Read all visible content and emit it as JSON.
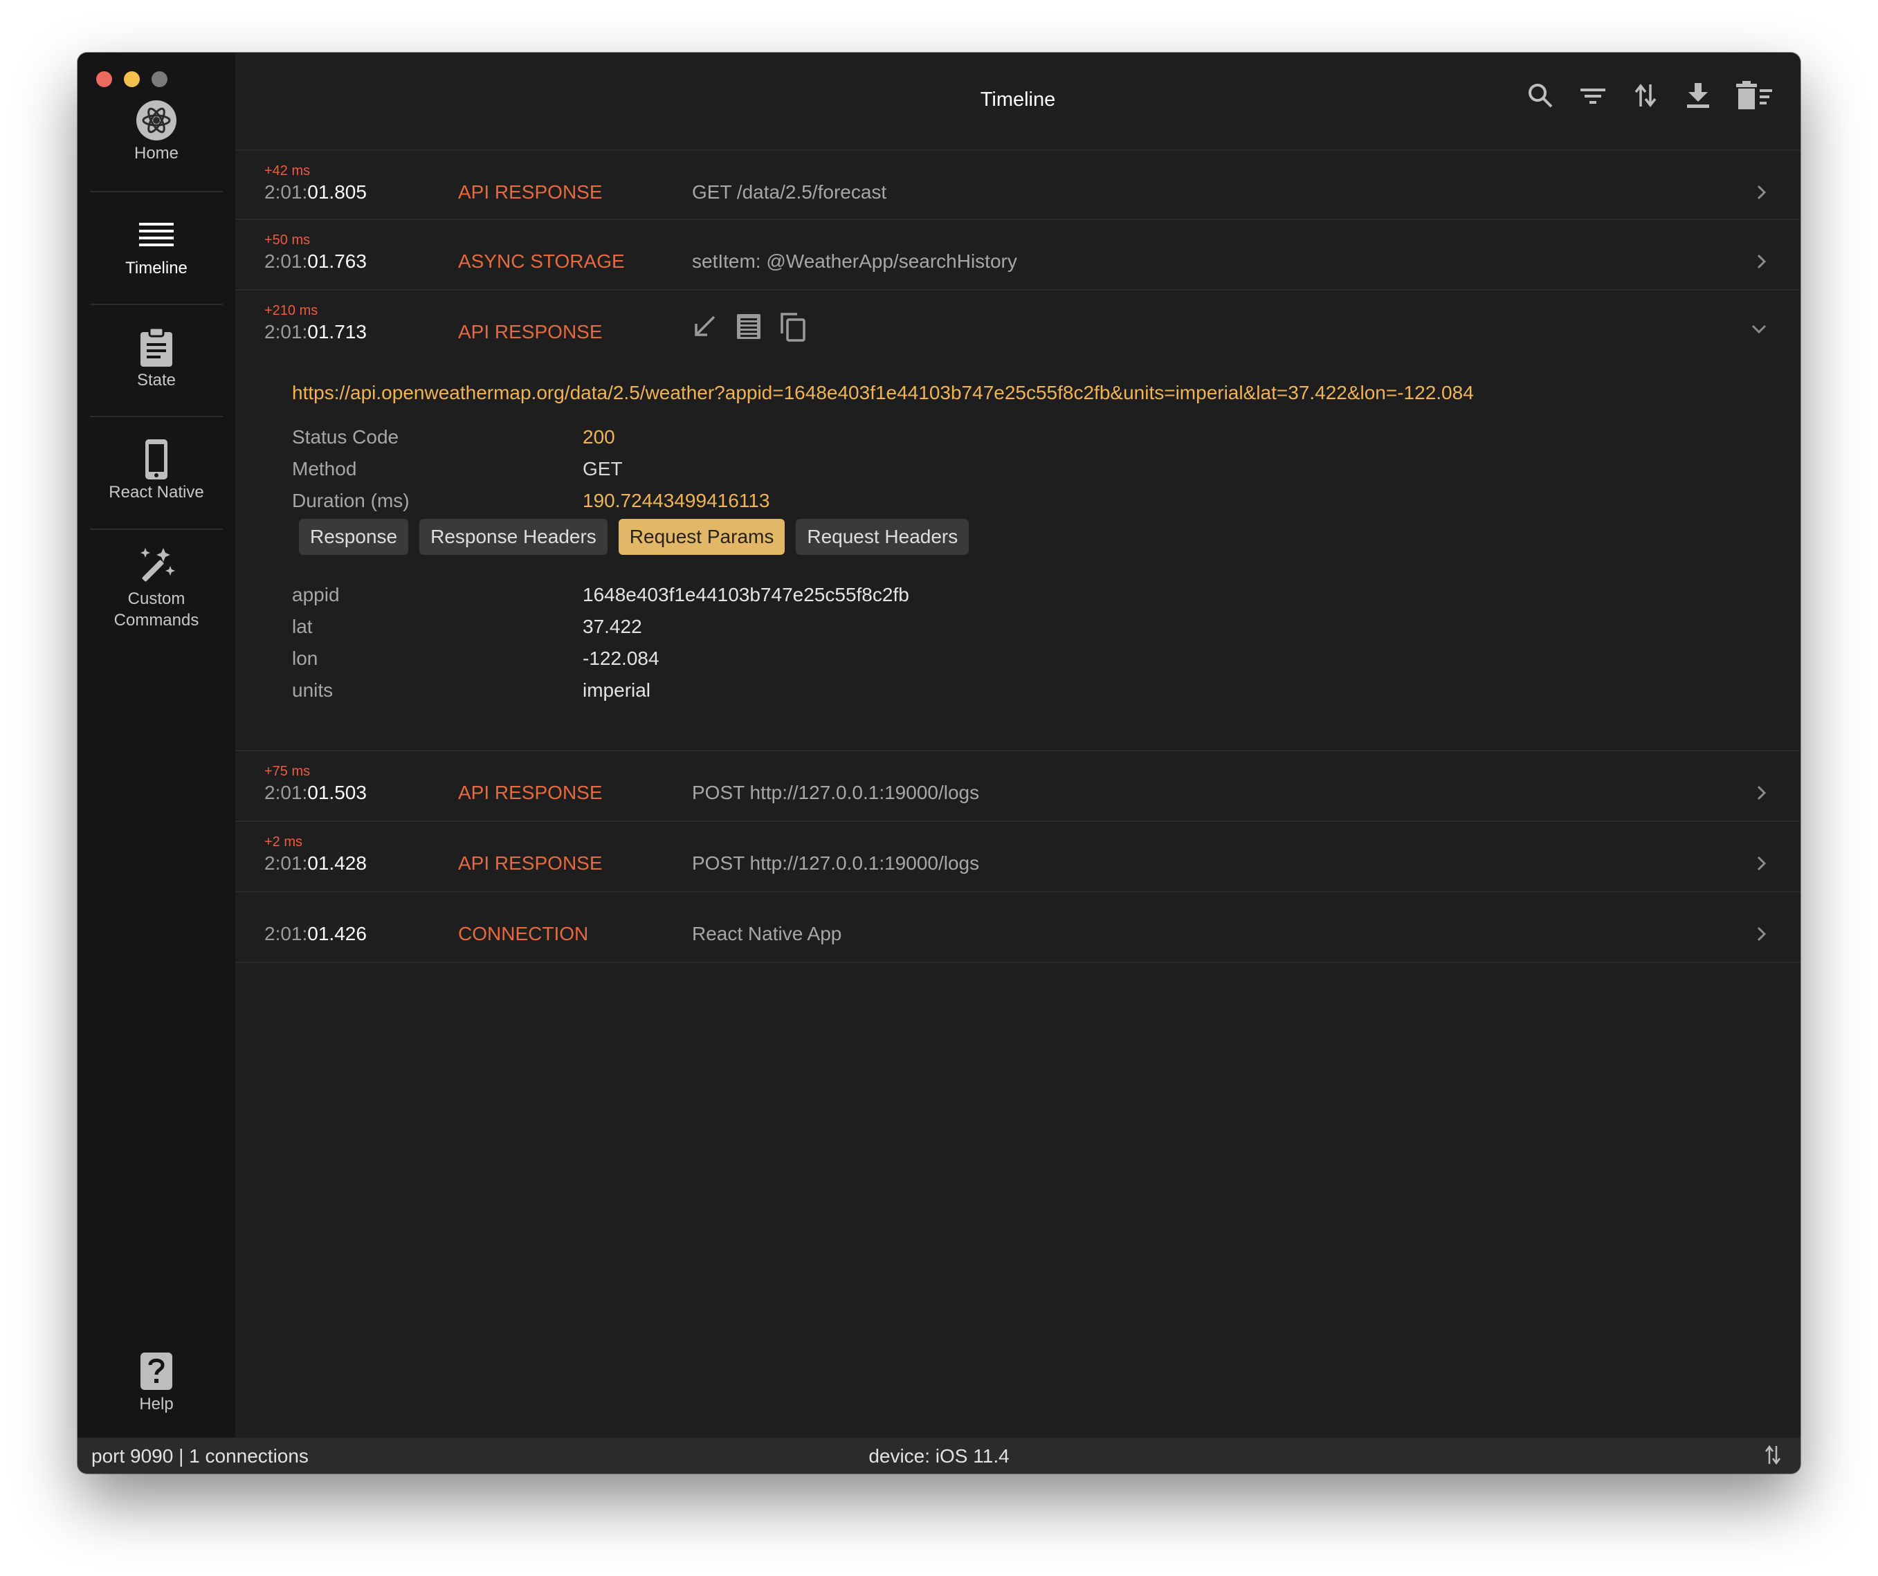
{
  "window": {
    "title": "Timeline",
    "traffic_lights": [
      "#ed6a5e",
      "#f5bf4f",
      "#7b7b7b"
    ]
  },
  "sidebar": {
    "items": [
      {
        "label": "Home",
        "icon": "reactotron-logo-icon",
        "active": false
      },
      {
        "label": "Timeline",
        "icon": "list-icon",
        "active": true
      },
      {
        "label": "State",
        "icon": "clipboard-icon",
        "active": false
      },
      {
        "label": "React Native",
        "icon": "phone-icon",
        "active": false
      },
      {
        "label": "Custom Commands",
        "icon": "magic-wand-icon",
        "active": false
      }
    ],
    "help": {
      "label": "Help",
      "icon": "help-icon"
    }
  },
  "header": {
    "title": "Timeline",
    "tools": [
      "search-icon",
      "filter-icon",
      "reverse-order-icon",
      "download-icon",
      "clear-icon"
    ]
  },
  "timeline": {
    "rows": [
      {
        "delta": "+42 ms",
        "time_hm": "2:01:",
        "time_sms": "01.805",
        "type": "API RESPONSE",
        "summary": "GET /data/2.5/forecast"
      },
      {
        "delta": "+50 ms",
        "time_hm": "2:01:",
        "time_sms": "01.763",
        "type": "ASYNC STORAGE",
        "summary": "setItem: @WeatherApp/searchHistory"
      },
      {
        "delta": "+210 ms",
        "time_hm": "2:01:",
        "time_sms": "01.713",
        "type": "API RESPONSE",
        "summary": "",
        "expanded": true
      },
      {
        "delta": "+75 ms",
        "time_hm": "2:01:",
        "time_sms": "01.503",
        "type": "API RESPONSE",
        "summary": "POST http://127.0.0.1:19000/logs"
      },
      {
        "delta": "+2 ms",
        "time_hm": "2:01:",
        "time_sms": "01.428",
        "type": "API RESPONSE",
        "summary": "POST http://127.0.0.1:19000/logs"
      },
      {
        "delta": "",
        "time_hm": "2:01:",
        "time_sms": "01.426",
        "type": "CONNECTION",
        "summary": "React Native App"
      }
    ],
    "expanded": {
      "actions": [
        "repeat-request-icon",
        "copy-as-fetch-icon",
        "copy-icon"
      ],
      "url": "https://api.openweathermap.org/data/2.5/weather?appid=1648e403f1e44103b747e25c55f8c2fb&units=imperial&lat=37.422&lon=-122.084",
      "info": [
        {
          "key": "Status Code",
          "value": "200"
        },
        {
          "key": "Method",
          "value": "GET"
        },
        {
          "key": "Duration (ms)",
          "value": "190.72443499416113"
        }
      ],
      "tabs": [
        "Response",
        "Response Headers",
        "Request Params",
        "Request Headers"
      ],
      "active_tab": "Request Params",
      "params": [
        {
          "key": "appid",
          "value": "1648e403f1e44103b747e25c55f8c2fb"
        },
        {
          "key": "lat",
          "value": "37.422"
        },
        {
          "key": "lon",
          "value": "-122.084"
        },
        {
          "key": "units",
          "value": "imperial"
        }
      ]
    }
  },
  "statusbar": {
    "left": "port 9090 | 1 connections",
    "center": "device: iOS 11.4",
    "right_icon": "reverse-order-icon"
  },
  "colors": {
    "accent": "#f0b454",
    "event_type": "#e66a3e",
    "delta": "#f05a3c",
    "tab_active": "#e2b768"
  }
}
